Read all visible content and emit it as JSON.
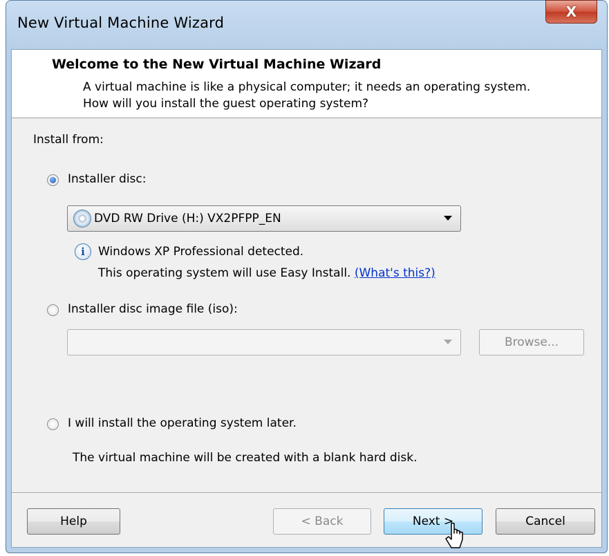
{
  "window": {
    "title": "New Virtual Machine Wizard",
    "close_glyph": "X"
  },
  "header": {
    "title": "Welcome to the New Virtual Machine Wizard",
    "description": "A virtual machine is like a physical computer; it needs an operating system. How will you install the guest operating system?"
  },
  "body": {
    "install_from_label": "Install from:",
    "option_disc": {
      "label": "Installer disc:",
      "selected": true,
      "drive_value": "DVD RW Drive (H:) VX2PFPP_EN"
    },
    "detection": {
      "line1": "Windows XP Professional detected.",
      "line2": "This operating system will use Easy Install.",
      "link": "(What's this?)"
    },
    "option_iso": {
      "label": "Installer disc image file (iso):",
      "selected": false,
      "path_value": "",
      "browse_label": "Browse..."
    },
    "option_later": {
      "label": "I will install the operating system later.",
      "selected": false,
      "note": "The virtual machine will be created with a blank hard disk."
    }
  },
  "footer": {
    "help_label": "Help",
    "back_label": "< Back",
    "next_label": "Next >",
    "cancel_label": "Cancel"
  },
  "colors": {
    "link": "#0033cc",
    "close_button": "#c03a22",
    "frame": "#b7cfe8"
  },
  "icons": [
    "close-icon",
    "dvd-drive-icon",
    "info-icon",
    "dropdown-arrow-icon",
    "mouse-pointer-icon"
  ]
}
